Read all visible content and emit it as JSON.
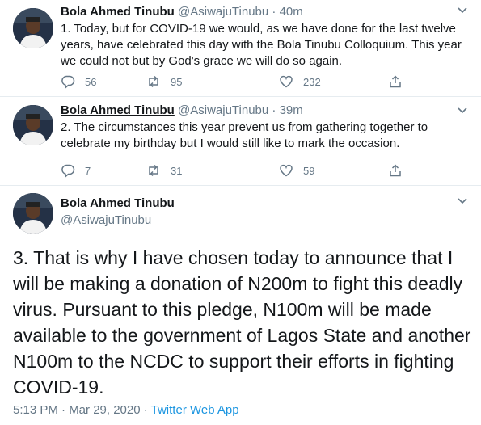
{
  "tweets": [
    {
      "name": "Bola Ahmed Tinubu",
      "handle": "@AsiwajuTinubu",
      "separator": "·",
      "time": "40m",
      "text": "1. Today, but for COVID-19 we would, as we have done for the last twelve years, have celebrated this day with the Bola Tinubu Colloquium. This year we could not but by God's grace we will do so again.",
      "replies": "56",
      "retweets": "95",
      "likes": "232"
    },
    {
      "name": "Bola Ahmed Tinubu",
      "handle": "@AsiwajuTinubu",
      "separator": "·",
      "time": "39m",
      "text": "2. The circumstances this year prevent us from gathering together to celebrate my birthday but I would still like to mark the occasion.",
      "replies": "7",
      "retweets": "31",
      "likes": "59"
    }
  ],
  "main_tweet": {
    "name": "Bola Ahmed Tinubu",
    "handle": "@AsiwajuTinubu",
    "text": "3. That is why I have chosen today to announce that I will be making a donation of N200m to fight this deadly virus. Pursuant to this pledge, N100m will be made available to the government of Lagos State and another N100m to the NCDC to support their efforts in fighting COVID-19.",
    "timestamp": "5:13 PM · Mar 29, 2020 · ",
    "source": "Twitter Web App"
  },
  "icons": {
    "reply": "reply-icon",
    "retweet": "retweet-icon",
    "like": "heart-icon",
    "share": "share-icon",
    "menu": "chevron-down-icon"
  },
  "colors": {
    "text": "#14171a",
    "secondary": "#657786",
    "link": "#1b95e0",
    "divider": "#e6ecf0"
  }
}
